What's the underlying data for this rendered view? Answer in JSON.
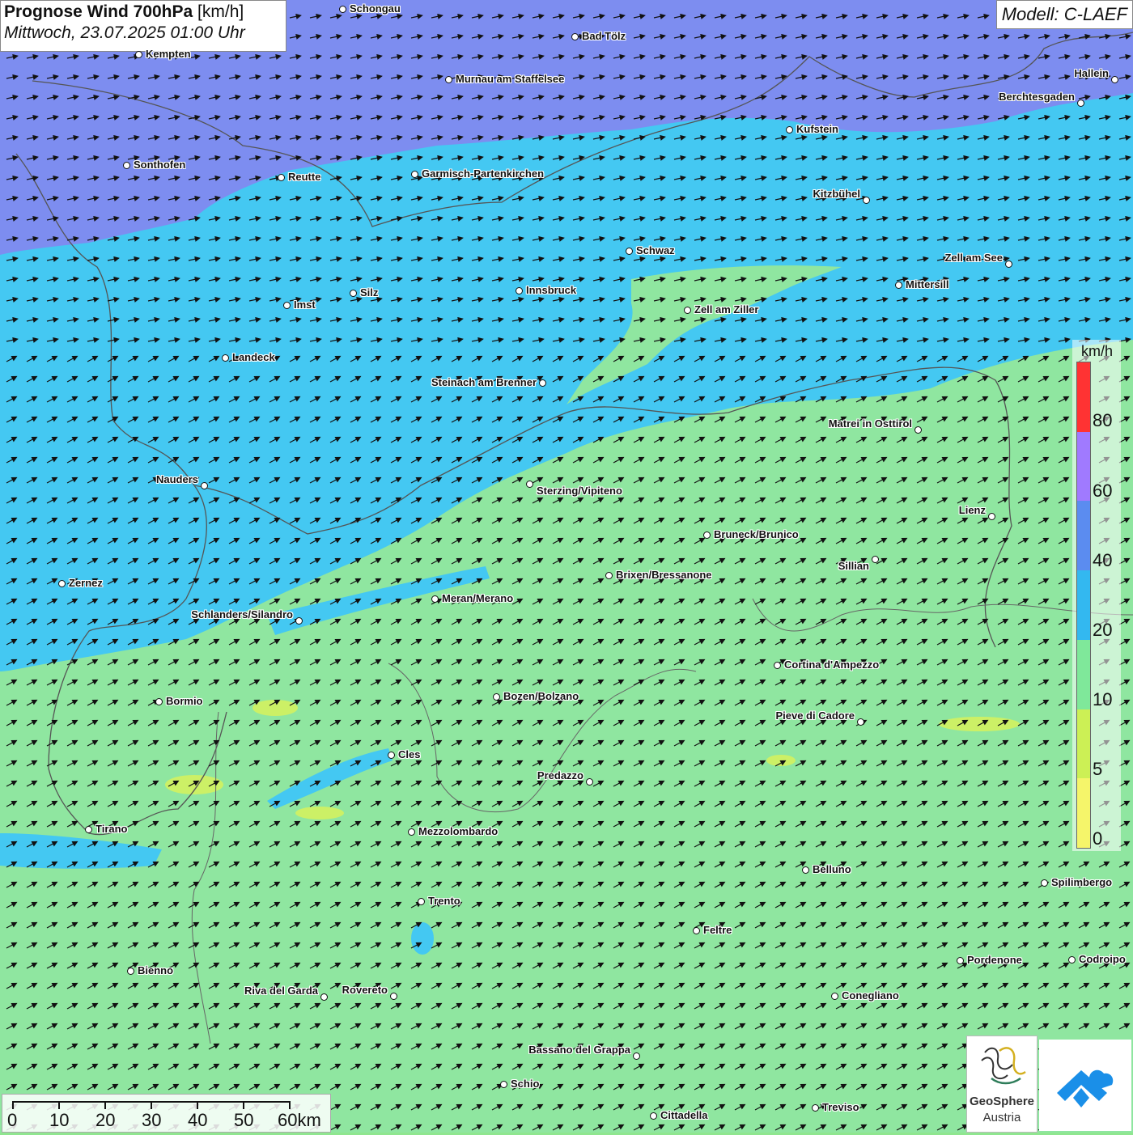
{
  "title": {
    "main_bold": "Prognose Wind 700hPa",
    "main_unit": "[km/h]",
    "datetime": "Mittwoch, 23.07.2025 01:00 Uhr"
  },
  "model_label": "Modell: C-LAEF",
  "legend": {
    "unit": "km/h",
    "labels": [
      "80",
      "60",
      "40",
      "20",
      "10",
      "5",
      "0"
    ],
    "colors": [
      "#ff3333",
      "#a07aff",
      "#5b8cf0",
      "#33b8f0",
      "#7fe89a",
      "#ccf055",
      "#f5f56a"
    ]
  },
  "scale": {
    "labels": [
      "0",
      "10",
      "20",
      "30",
      "40",
      "50",
      "60km"
    ]
  },
  "logos": {
    "geosphere_line1": "GeoSphere",
    "geosphere_line2": "Austria"
  },
  "cities": [
    {
      "name": "Schongau"
    },
    {
      "name": "Bad Tölz"
    },
    {
      "name": "Kempten"
    },
    {
      "name": "Murnau am Staffelsee"
    },
    {
      "name": "Hallein"
    },
    {
      "name": "Berchtesgaden"
    },
    {
      "name": "Kufstein"
    },
    {
      "name": "Sonthofen"
    },
    {
      "name": "Reutte"
    },
    {
      "name": "Garmisch-Partenkirchen"
    },
    {
      "name": "Kitzbühel"
    },
    {
      "name": "Schwaz"
    },
    {
      "name": "Zell am See"
    },
    {
      "name": "Mittersill"
    },
    {
      "name": "Innsbruck"
    },
    {
      "name": "Silz"
    },
    {
      "name": "Imst"
    },
    {
      "name": "Zell am Ziller"
    },
    {
      "name": "Landeck"
    },
    {
      "name": "Steinach am Brenner"
    },
    {
      "name": "Matrei in Osttirol"
    },
    {
      "name": "Nauders"
    },
    {
      "name": "Sterzing/Vipiteno"
    },
    {
      "name": "Lienz"
    },
    {
      "name": "Bruneck/Brunico"
    },
    {
      "name": "Sillian"
    },
    {
      "name": "Zernez"
    },
    {
      "name": "Brixen/Bressanone"
    },
    {
      "name": "Meran/Merano"
    },
    {
      "name": "Schlanders/Silandro"
    },
    {
      "name": "Cortina d'Ampezzo"
    },
    {
      "name": "Bozen/Bolzano"
    },
    {
      "name": "Bormio"
    },
    {
      "name": "Pieve di Cadore"
    },
    {
      "name": "Cles"
    },
    {
      "name": "Predazzo"
    },
    {
      "name": "Tirano"
    },
    {
      "name": "Mezzolombardo"
    },
    {
      "name": "Belluno"
    },
    {
      "name": "Spilimbergo"
    },
    {
      "name": "Trento"
    },
    {
      "name": "Feltre"
    },
    {
      "name": "Pordenone"
    },
    {
      "name": "Codroipo"
    },
    {
      "name": "Bienno"
    },
    {
      "name": "Riva del Garda"
    },
    {
      "name": "Rovereto"
    },
    {
      "name": "Conegliano"
    },
    {
      "name": "Bassano del Grappa"
    },
    {
      "name": "Schio"
    },
    {
      "name": "Treviso"
    },
    {
      "name": "Cittadella"
    }
  ]
}
